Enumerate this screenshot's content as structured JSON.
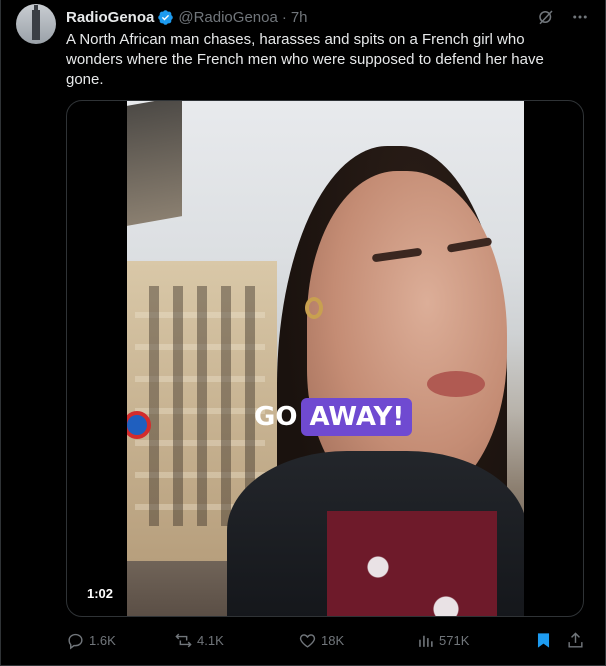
{
  "post": {
    "author_name": "RadioGenoa",
    "handle": "@RadioGenoa",
    "separator": "·",
    "time": "7h",
    "text": "A North African man chases, harasses and spits on a French girl who wonders where the French men who were supposed to defend her have gone."
  },
  "media": {
    "caption_word_1": "GO",
    "caption_word_2": "AWAY!",
    "duration": "1:02"
  },
  "actions": {
    "replies": "1.6K",
    "reposts": "4.1K",
    "likes": "18K",
    "views": "571K"
  },
  "icons": {
    "verified": "verified-badge-icon",
    "grok": "grok-icon",
    "more": "more-icon",
    "reply": "reply-icon",
    "repost": "repost-icon",
    "like": "heart-icon",
    "views": "views-icon",
    "bookmark": "bookmark-icon",
    "share": "share-icon"
  },
  "colors": {
    "background": "#000000",
    "text": "#e7e9ea",
    "muted": "#71767b",
    "accent": "#1d9bf0",
    "caption_highlight": "#6f4ad1"
  }
}
